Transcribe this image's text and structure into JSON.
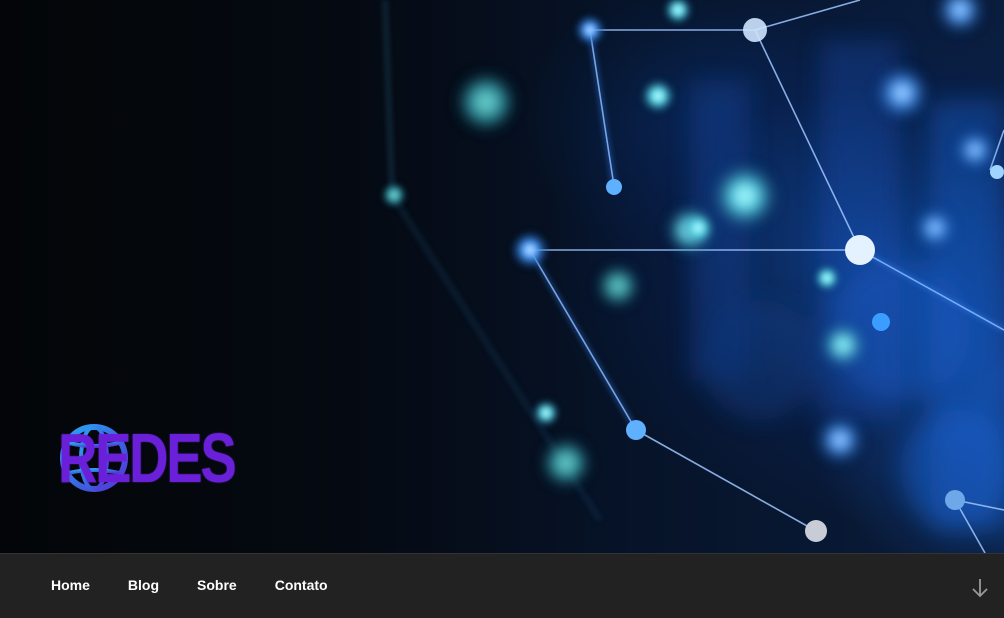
{
  "header": {
    "logo": {
      "text": "REDES",
      "icon": "globe-icon",
      "color": "#6a1fd8"
    },
    "background": "network-nodes-image"
  },
  "nav": {
    "items": [
      {
        "label": "Home"
      },
      {
        "label": "Blog"
      },
      {
        "label": "Sobre"
      },
      {
        "label": "Contato"
      }
    ],
    "scroll_icon": "arrow-down-icon"
  },
  "colors": {
    "navbar_bg": "#222222",
    "nav_text": "#ffffff",
    "accent_blue": "#3da5ff"
  }
}
